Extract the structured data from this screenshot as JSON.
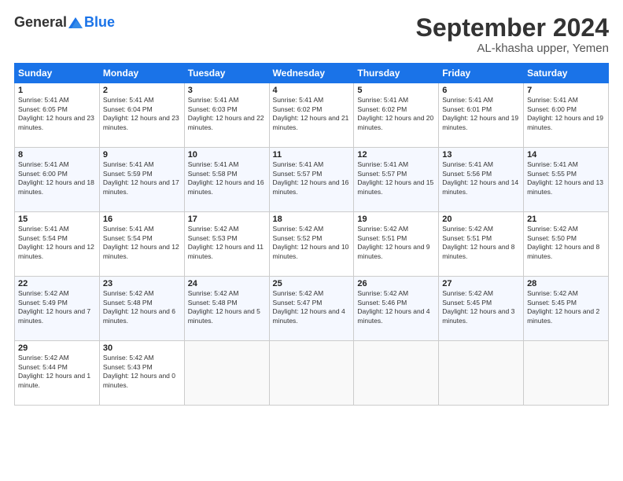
{
  "header": {
    "logo_line1": "General",
    "logo_line2": "Blue",
    "month": "September 2024",
    "location": "AL-khasha upper, Yemen"
  },
  "days_of_week": [
    "Sunday",
    "Monday",
    "Tuesday",
    "Wednesday",
    "Thursday",
    "Friday",
    "Saturday"
  ],
  "weeks": [
    [
      {
        "day": "1",
        "sunrise": "5:41 AM",
        "sunset": "6:05 PM",
        "daylight": "12 hours and 23 minutes."
      },
      {
        "day": "2",
        "sunrise": "5:41 AM",
        "sunset": "6:04 PM",
        "daylight": "12 hours and 23 minutes."
      },
      {
        "day": "3",
        "sunrise": "5:41 AM",
        "sunset": "6:03 PM",
        "daylight": "12 hours and 22 minutes."
      },
      {
        "day": "4",
        "sunrise": "5:41 AM",
        "sunset": "6:02 PM",
        "daylight": "12 hours and 21 minutes."
      },
      {
        "day": "5",
        "sunrise": "5:41 AM",
        "sunset": "6:02 PM",
        "daylight": "12 hours and 20 minutes."
      },
      {
        "day": "6",
        "sunrise": "5:41 AM",
        "sunset": "6:01 PM",
        "daylight": "12 hours and 19 minutes."
      },
      {
        "day": "7",
        "sunrise": "5:41 AM",
        "sunset": "6:00 PM",
        "daylight": "12 hours and 19 minutes."
      }
    ],
    [
      {
        "day": "8",
        "sunrise": "5:41 AM",
        "sunset": "6:00 PM",
        "daylight": "12 hours and 18 minutes."
      },
      {
        "day": "9",
        "sunrise": "5:41 AM",
        "sunset": "5:59 PM",
        "daylight": "12 hours and 17 minutes."
      },
      {
        "day": "10",
        "sunrise": "5:41 AM",
        "sunset": "5:58 PM",
        "daylight": "12 hours and 16 minutes."
      },
      {
        "day": "11",
        "sunrise": "5:41 AM",
        "sunset": "5:57 PM",
        "daylight": "12 hours and 16 minutes."
      },
      {
        "day": "12",
        "sunrise": "5:41 AM",
        "sunset": "5:57 PM",
        "daylight": "12 hours and 15 minutes."
      },
      {
        "day": "13",
        "sunrise": "5:41 AM",
        "sunset": "5:56 PM",
        "daylight": "12 hours and 14 minutes."
      },
      {
        "day": "14",
        "sunrise": "5:41 AM",
        "sunset": "5:55 PM",
        "daylight": "12 hours and 13 minutes."
      }
    ],
    [
      {
        "day": "15",
        "sunrise": "5:41 AM",
        "sunset": "5:54 PM",
        "daylight": "12 hours and 12 minutes."
      },
      {
        "day": "16",
        "sunrise": "5:41 AM",
        "sunset": "5:54 PM",
        "daylight": "12 hours and 12 minutes."
      },
      {
        "day": "17",
        "sunrise": "5:42 AM",
        "sunset": "5:53 PM",
        "daylight": "12 hours and 11 minutes."
      },
      {
        "day": "18",
        "sunrise": "5:42 AM",
        "sunset": "5:52 PM",
        "daylight": "12 hours and 10 minutes."
      },
      {
        "day": "19",
        "sunrise": "5:42 AM",
        "sunset": "5:51 PM",
        "daylight": "12 hours and 9 minutes."
      },
      {
        "day": "20",
        "sunrise": "5:42 AM",
        "sunset": "5:51 PM",
        "daylight": "12 hours and 8 minutes."
      },
      {
        "day": "21",
        "sunrise": "5:42 AM",
        "sunset": "5:50 PM",
        "daylight": "12 hours and 8 minutes."
      }
    ],
    [
      {
        "day": "22",
        "sunrise": "5:42 AM",
        "sunset": "5:49 PM",
        "daylight": "12 hours and 7 minutes."
      },
      {
        "day": "23",
        "sunrise": "5:42 AM",
        "sunset": "5:48 PM",
        "daylight": "12 hours and 6 minutes."
      },
      {
        "day": "24",
        "sunrise": "5:42 AM",
        "sunset": "5:48 PM",
        "daylight": "12 hours and 5 minutes."
      },
      {
        "day": "25",
        "sunrise": "5:42 AM",
        "sunset": "5:47 PM",
        "daylight": "12 hours and 4 minutes."
      },
      {
        "day": "26",
        "sunrise": "5:42 AM",
        "sunset": "5:46 PM",
        "daylight": "12 hours and 4 minutes."
      },
      {
        "day": "27",
        "sunrise": "5:42 AM",
        "sunset": "5:45 PM",
        "daylight": "12 hours and 3 minutes."
      },
      {
        "day": "28",
        "sunrise": "5:42 AM",
        "sunset": "5:45 PM",
        "daylight": "12 hours and 2 minutes."
      }
    ],
    [
      {
        "day": "29",
        "sunrise": "5:42 AM",
        "sunset": "5:44 PM",
        "daylight": "12 hours and 1 minute."
      },
      {
        "day": "30",
        "sunrise": "5:42 AM",
        "sunset": "5:43 PM",
        "daylight": "12 hours and 0 minutes."
      },
      null,
      null,
      null,
      null,
      null
    ]
  ]
}
